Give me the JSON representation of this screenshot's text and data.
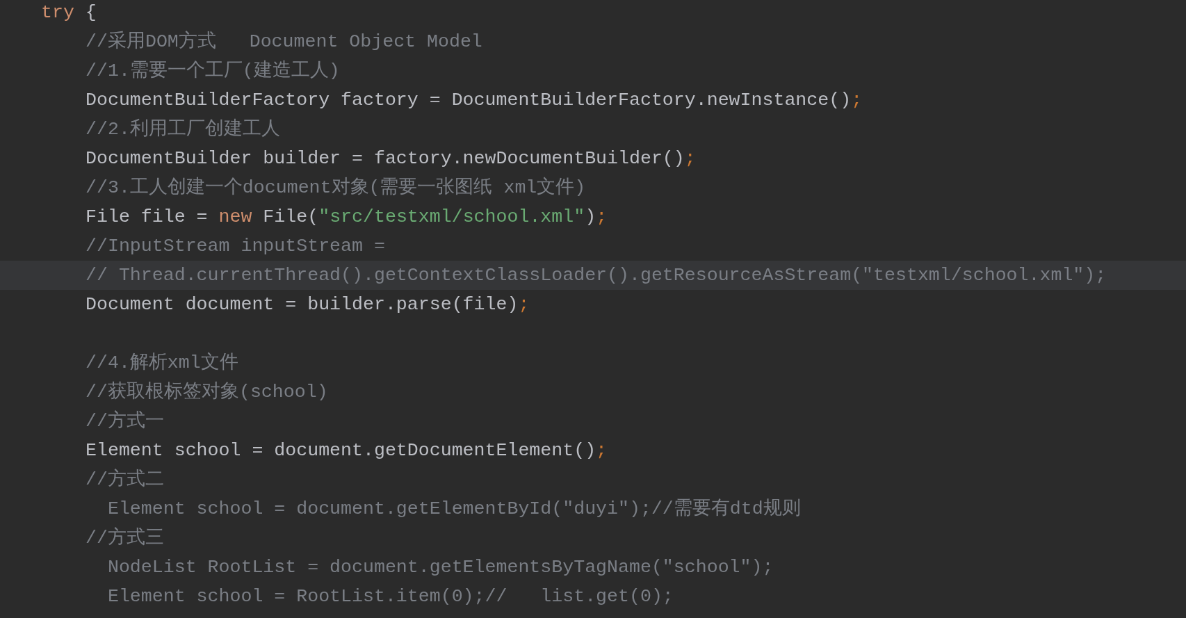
{
  "editor": {
    "lines": [
      {
        "kind": "code",
        "current": false,
        "tokens": [
          {
            "kind": "keyword",
            "text": "try"
          },
          {
            "kind": "plain",
            "text": " {"
          }
        ],
        "children": [
          {
            "kind": "code",
            "current": false,
            "tokens": [
              {
                "kind": "comment",
                "text": "//采用DOM方式   Document Object Model"
              }
            ]
          },
          {
            "kind": "code",
            "current": false,
            "tokens": [
              {
                "kind": "comment",
                "text": "//1.需要一个工厂(建造工人)"
              }
            ]
          },
          {
            "kind": "code",
            "current": false,
            "tokens": [
              {
                "kind": "plain",
                "text": "DocumentBuilderFactory factory = DocumentBuilderFactory.newInstance()"
              },
              {
                "kind": "semicolon",
                "text": ";"
              }
            ]
          },
          {
            "kind": "code",
            "current": false,
            "tokens": [
              {
                "kind": "comment",
                "text": "//2.利用工厂创建工人"
              }
            ]
          },
          {
            "kind": "code",
            "current": false,
            "tokens": [
              {
                "kind": "plain",
                "text": "DocumentBuilder builder = factory.newDocumentBuilder()"
              },
              {
                "kind": "semicolon",
                "text": ";"
              }
            ]
          },
          {
            "kind": "code",
            "current": false,
            "tokens": [
              {
                "kind": "comment",
                "text": "//3.工人创建一个document对象(需要一张图纸 xml文件)"
              }
            ]
          },
          {
            "kind": "code",
            "current": false,
            "tokens": [
              {
                "kind": "plain",
                "text": "File file = "
              },
              {
                "kind": "keyword",
                "text": "new"
              },
              {
                "kind": "plain",
                "text": " File("
              },
              {
                "kind": "string",
                "text": "\"src/testxml/school.xml\""
              },
              {
                "kind": "plain",
                "text": ")"
              },
              {
                "kind": "semicolon",
                "text": ";"
              }
            ]
          },
          {
            "kind": "code",
            "current": false,
            "tokens": [
              {
                "kind": "comment",
                "text": "//InputStream inputStream ="
              }
            ]
          },
          {
            "kind": "code",
            "current": true,
            "tokens": [
              {
                "kind": "comment",
                "text": "// Thread.currentThread().getContextClassLoader().getResourceAsStream(\"testxml/school.xml\");"
              }
            ]
          },
          {
            "kind": "code",
            "current": false,
            "tokens": [
              {
                "kind": "plain",
                "text": "Document document = builder.parse(file)"
              },
              {
                "kind": "semicolon",
                "text": ";"
              }
            ]
          },
          {
            "kind": "blank",
            "current": false
          },
          {
            "kind": "code",
            "current": false,
            "tokens": [
              {
                "kind": "comment",
                "text": "//4.解析xml文件"
              }
            ]
          },
          {
            "kind": "code",
            "current": false,
            "tokens": [
              {
                "kind": "comment",
                "text": "//获取根标签对象(school)"
              }
            ]
          },
          {
            "kind": "code",
            "current": false,
            "tokens": [
              {
                "kind": "comment",
                "text": "//方式一"
              }
            ]
          },
          {
            "kind": "code",
            "current": false,
            "tokens": [
              {
                "kind": "plain",
                "text": "Element school = document.getDocumentElement()"
              },
              {
                "kind": "semicolon",
                "text": ";"
              }
            ]
          },
          {
            "kind": "code",
            "current": false,
            "tokens": [
              {
                "kind": "comment",
                "text": "//方式二"
              }
            ]
          },
          {
            "kind": "code",
            "current": false,
            "tokens": [
              {
                "kind": "comment",
                "text": "  Element school = document.getElementById(\"duyi\");//需要有dtd规则"
              }
            ]
          },
          {
            "kind": "code",
            "current": false,
            "tokens": [
              {
                "kind": "comment",
                "text": "//方式三"
              }
            ]
          },
          {
            "kind": "code",
            "current": false,
            "tokens": [
              {
                "kind": "comment",
                "text": "  NodeList RootList = document.getElementsByTagName(\"school\");"
              }
            ]
          },
          {
            "kind": "code",
            "current": false,
            "tokens": [
              {
                "kind": "comment",
                "text": "  Element school = RootList.item(0);//   list.get(0);"
              }
            ]
          }
        ]
      }
    ]
  }
}
